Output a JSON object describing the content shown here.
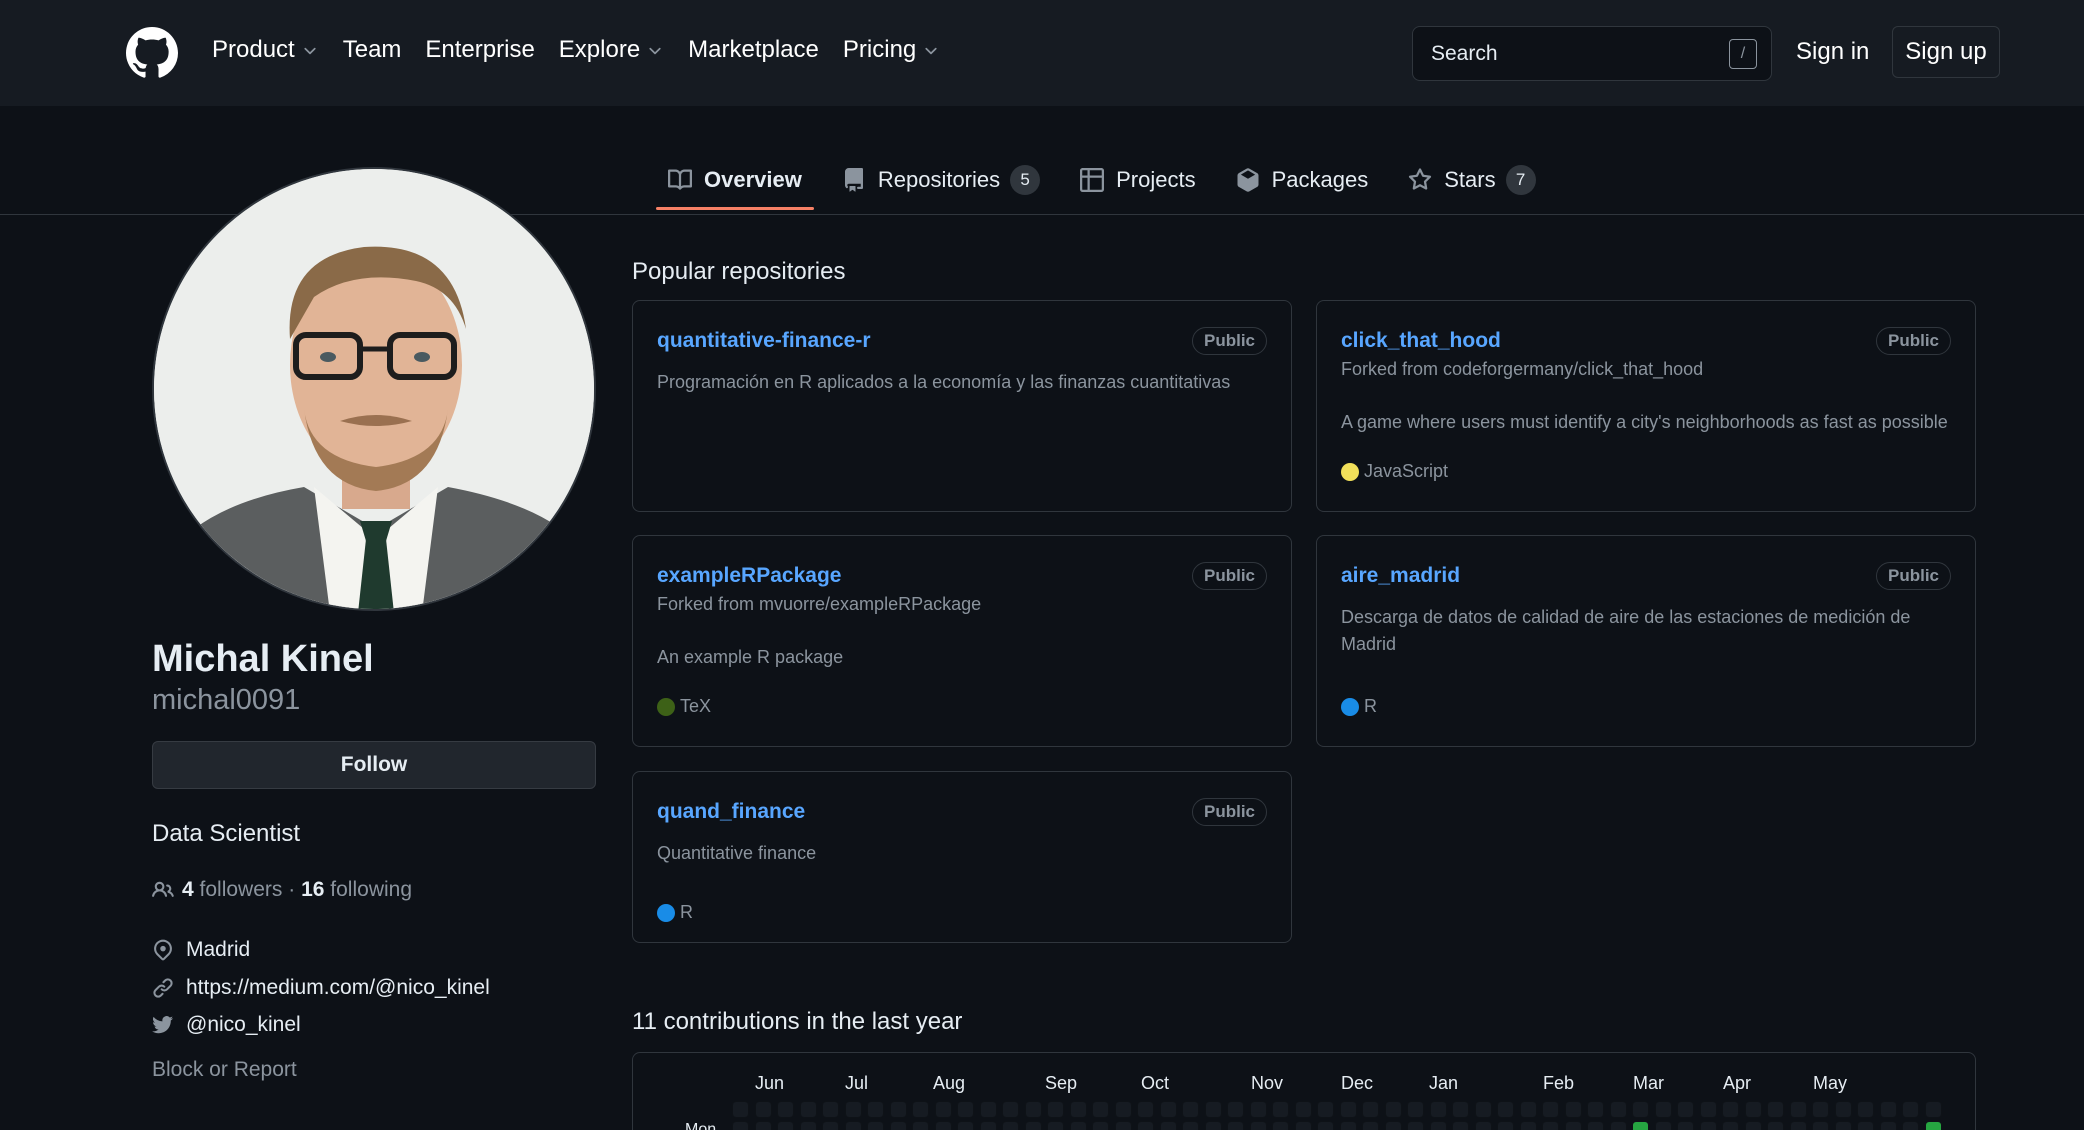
{
  "header": {
    "nav": [
      {
        "label": "Product",
        "dropdown": true
      },
      {
        "label": "Team",
        "dropdown": false
      },
      {
        "label": "Enterprise",
        "dropdown": false
      },
      {
        "label": "Explore",
        "dropdown": true
      },
      {
        "label": "Marketplace",
        "dropdown": false
      },
      {
        "label": "Pricing",
        "dropdown": true
      }
    ],
    "search_placeholder": "Search",
    "search_shortcut": "/",
    "signin": "Sign in",
    "signup": "Sign up"
  },
  "tabs": [
    {
      "label": "Overview",
      "icon": "book-icon",
      "count": null,
      "active": true
    },
    {
      "label": "Repositories",
      "icon": "repo-icon",
      "count": "5",
      "active": false
    },
    {
      "label": "Projects",
      "icon": "table-icon",
      "count": null,
      "active": false
    },
    {
      "label": "Packages",
      "icon": "package-icon",
      "count": null,
      "active": false
    },
    {
      "label": "Stars",
      "icon": "star-icon",
      "count": "7",
      "active": false
    }
  ],
  "profile": {
    "fullname": "Michal Kinel",
    "username": "michal0091",
    "follow": "Follow",
    "bio": "Data Scientist",
    "followers": "4",
    "followers_label": "followers",
    "sep": "·",
    "following": "16",
    "following_label": "following",
    "location": "Madrid",
    "website": "https://medium.com/@nico_kinel",
    "twitter": "@nico_kinel",
    "block": "Block or Report"
  },
  "popular": {
    "title": "Popular repositories",
    "repos": [
      {
        "name": "quantitative-finance-r",
        "visibility": "Public",
        "forked": "",
        "description": "Programación en R aplicados a la economía y las finanzas cuantitativas",
        "language": "",
        "language_color": ""
      },
      {
        "name": "click_that_hood",
        "visibility": "Public",
        "forked": "Forked from codeforgermany/click_that_hood",
        "description": "A game where users must identify a city's neighborhoods as fast as possible",
        "language": "JavaScript",
        "language_color": "#f1e05a"
      },
      {
        "name": "exampleRPackage",
        "visibility": "Public",
        "forked": "Forked from mvuorre/exampleRPackage",
        "description": "An example R package",
        "language": "TeX",
        "language_color": "#3d6117"
      },
      {
        "name": "aire_madrid",
        "visibility": "Public",
        "forked": "",
        "description": "Descarga de datos de calidad de aire de las estaciones de medición de Madrid",
        "language": "R",
        "language_color": "#198ce7"
      },
      {
        "name": "quand_finance",
        "visibility": "Public",
        "forked": "",
        "description": "Quantitative finance",
        "language": "R",
        "language_color": "#198ce7"
      }
    ]
  },
  "contributions": {
    "title": "11 contributions in the last year",
    "months": [
      "Jun",
      "Jul",
      "Aug",
      "Sep",
      "Oct",
      "Nov",
      "Dec",
      "Jan",
      "Feb",
      "Mar",
      "Apr",
      "May"
    ],
    "day_label": "Mon",
    "active_weeks": [
      40,
      53
    ],
    "colors": {
      "empty": "#161b22",
      "level2": "#26a641"
    }
  }
}
